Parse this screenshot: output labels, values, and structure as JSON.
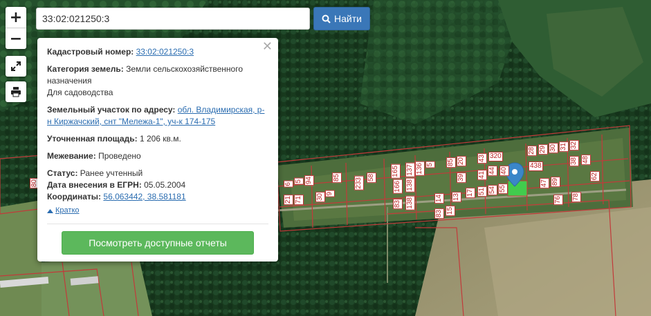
{
  "search": {
    "value": "33:02:021250:3",
    "button_label": "Найти"
  },
  "zoom": {
    "in_label": "+",
    "out_label": "−"
  },
  "info": {
    "cadastral_label": "Кадастровый номер:",
    "cadastral_value": "33:02:021250:3",
    "category_label": "Категория земель:",
    "category_value": "Земли сельскохозяйственного назначения",
    "category_use": "Для садоводства",
    "address_label": "Земельный участок по адресу:",
    "address_value": "обл. Владимирская, р-н Киржачский, снт \"Мележа-1\", уч-к 174-175",
    "area_label": "Уточненная площадь:",
    "area_value": "1 206 кв.м.",
    "survey_label": "Межевание:",
    "survey_value": "Проведено",
    "status_label": "Статус:",
    "status_value": "Ранее учтенный",
    "egrn_label": "Дата внесения в ЕГРН:",
    "egrn_value": "05.05.2004",
    "coords_label": "Координаты:",
    "coords_value": "56.063442, 38.581181",
    "brief_label": "Кратко",
    "reports_label": "Посмотреть доступные отчеты"
  },
  "icons": {
    "search": "search-icon",
    "expand": "expand-icon",
    "print": "print-icon",
    "close": "close-icon",
    "marker": "map-marker-icon",
    "caret": "caret-up-icon"
  },
  "colors": {
    "search_button": "#3a77b8",
    "reports_button": "#5cb85c",
    "link": "#2a6cb0",
    "plot_border": "#b33333",
    "marker": "#3b86c8",
    "selected_plot": "#3fd64f"
  },
  "plots": [
    "80",
    "6",
    "5",
    "94",
    "85",
    "233",
    "58",
    "148",
    "233",
    "165",
    "137",
    "136",
    "5",
    "85",
    "20",
    "320",
    "28",
    "29",
    "30",
    "31",
    "32",
    "38",
    "48",
    "49",
    "62",
    "39",
    "41",
    "43",
    "44",
    "40",
    "438",
    "47",
    "83",
    "89",
    "76",
    "78",
    "166",
    "138",
    "138",
    "14",
    "13",
    "17",
    "51",
    "54",
    "55",
    "83",
    "15",
    "30",
    "9",
    "21",
    "71"
  ]
}
